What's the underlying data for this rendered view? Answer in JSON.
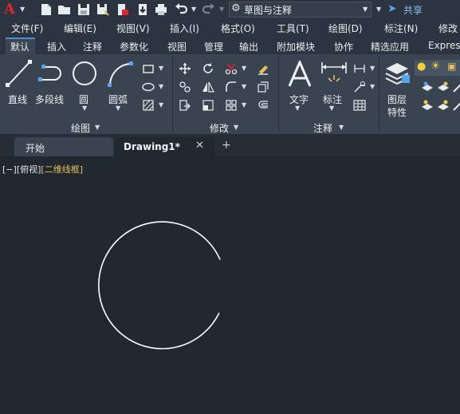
{
  "app": {
    "logo_letter": "A"
  },
  "workspace": {
    "label": "草图与注释"
  },
  "share": {
    "label": "共享"
  },
  "menu": [
    "文件(F)",
    "编辑(E)",
    "视图(V)",
    "插入(I)",
    "格式(O)",
    "工具(T)",
    "绘图(D)",
    "标注(N)",
    "修改"
  ],
  "ribbon_tabs": [
    "默认",
    "插入",
    "注释",
    "参数化",
    "视图",
    "管理",
    "输出",
    "附加模块",
    "协作",
    "精选应用",
    "Expres"
  ],
  "active_ribbon_tab": "默认",
  "draw_panel": {
    "tools": [
      "直线",
      "多段线",
      "圆",
      "圆弧"
    ],
    "title": "绘图"
  },
  "modify_panel": {
    "title": "修改"
  },
  "annotation_panel": {
    "tools": [
      "文字",
      "标注"
    ],
    "title": "注释"
  },
  "layers_panel": {
    "tool_line1": "图层",
    "tool_line2": "特性"
  },
  "document_tabs": {
    "start": "开始",
    "drawing": "Drawing1*"
  },
  "viewport": {
    "minus": "[−]",
    "view": "[俯视]",
    "style": "[二维线框]"
  },
  "colors": {
    "accent": "#4b8ed6",
    "canvas": "#212830",
    "arc": "#ffffff",
    "style_text": "#e2c25a"
  },
  "icons": [
    "autocad-logo-icon",
    "new-icon",
    "open-icon",
    "save-icon",
    "save-as-icon",
    "publish-icon",
    "import-icon",
    "print-icon",
    "undo-icon",
    "redo-icon",
    "gear-icon",
    "share-icon"
  ]
}
